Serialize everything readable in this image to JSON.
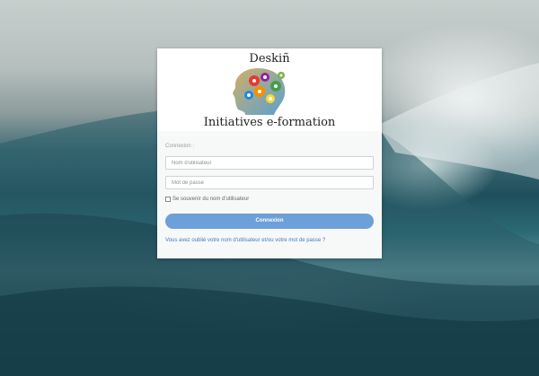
{
  "brand": {
    "top": "Deskiñ",
    "bottom": "Initiatives e-formation"
  },
  "form": {
    "legend": "Connexion :",
    "username_placeholder": "Nom d'utilisateur",
    "password_placeholder": "Mot de passe",
    "remember_label": "Se souvenir du nom d'utilisateur",
    "submit_label": "Connexion",
    "forgot_link": "Vous avez oublié votre nom d'utilisateur et/ou votre mot de passe ?"
  },
  "colors": {
    "button": "#6d9fd8",
    "link": "#3e7cc4"
  },
  "icons": {
    "logo": "head-gears-icon"
  }
}
